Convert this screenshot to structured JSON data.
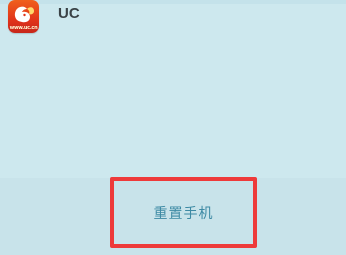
{
  "app": {
    "name": "UC",
    "icon": "uc-browser-squirrel-icon",
    "icon_caption": "www.uc.cn"
  },
  "action": {
    "reset_label": "重置手机"
  },
  "colors": {
    "background": "#cde8ee",
    "highlight_border": "#ee3a3a",
    "button_text": "#3d8aa4",
    "app_icon_bg": "#e1341a"
  }
}
